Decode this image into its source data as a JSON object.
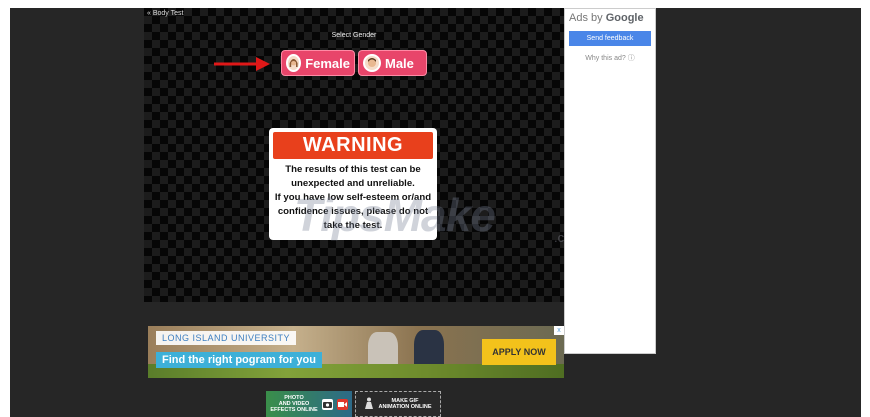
{
  "app": {
    "back_link": "« Body Test",
    "select_label": "Select Gender"
  },
  "gender_buttons": [
    {
      "label": "Female"
    },
    {
      "label": "Male"
    }
  ],
  "warning": {
    "title": "WARNING",
    "lines": [
      "The results of this test can be",
      "unexpected and unreliable.",
      "If you have low self-esteem or/and",
      "confidence issues, please do not",
      "take the test."
    ]
  },
  "watermark": {
    "main": "TipsMake",
    "domain": ".com"
  },
  "ads": {
    "ads_by": "Ads by",
    "google": "Google",
    "send_feedback": "Send feedback",
    "why_this_ad": "Why this ad? ⓘ"
  },
  "banner": {
    "university": "LONG ISLAND UNIVERSITY",
    "tagline": "Find the right pogram for you",
    "cta": "APPLY NOW",
    "close": "x"
  },
  "bottom_tiles": [
    {
      "line1": "PHOTO",
      "line2": "AND VIDEO",
      "line3": "EFFECTS ONLINE"
    },
    {
      "line1": "MAKE GIF",
      "line2": "ANIMATION ONLINE"
    }
  ],
  "colors": {
    "gender_button": "#e8456a",
    "warning_header": "#e8401c",
    "send_feedback": "#4a86e8",
    "apply_now": "#f3c21b",
    "arrow": "#e01818"
  }
}
